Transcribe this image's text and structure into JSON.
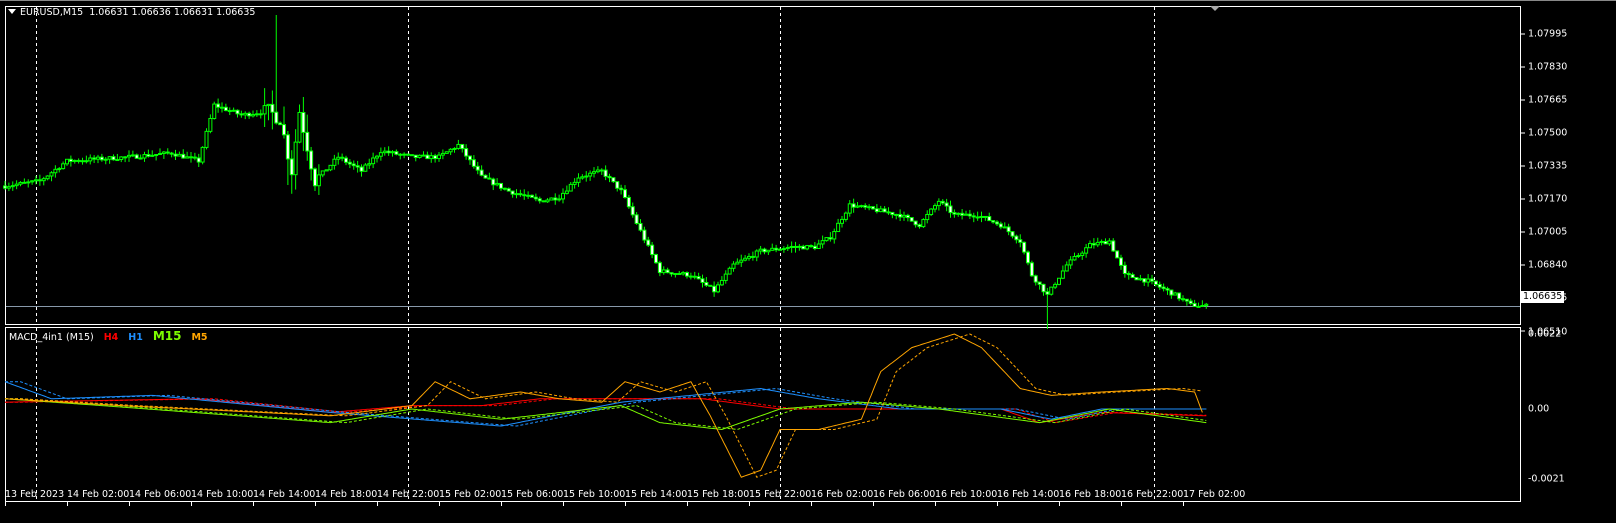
{
  "header": {
    "symbol": "EURUSD,M15",
    "quotes": "1.06631 1.06636 1.06631 1.06635"
  },
  "price_axis": {
    "labels": [
      "1.07995",
      "1.07830",
      "1.07665",
      "1.07500",
      "1.07335",
      "1.07170",
      "1.07005",
      "1.06840",
      "1.06675",
      "1.06510"
    ],
    "current_price": "1.06635"
  },
  "indicator": {
    "name": "MACD_4in1 (M15)",
    "legend": [
      {
        "label": "H4",
        "color": "#ff0000"
      },
      {
        "label": "H1",
        "color": "#1e90ff"
      },
      {
        "label": "M15",
        "color": "#7cfc00"
      },
      {
        "label": "M5",
        "color": "#ffa500"
      }
    ],
    "axis_labels": [
      "0.0022",
      "0.00",
      "-0.0021"
    ]
  },
  "time_axis": {
    "labels": [
      "13 Feb 2023",
      "14 Feb 02:00",
      "14 Feb 06:00",
      "14 Feb 10:00",
      "14 Feb 14:00",
      "14 Feb 18:00",
      "14 Feb 22:00",
      "15 Feb 02:00",
      "15 Feb 06:00",
      "15 Feb 10:00",
      "15 Feb 14:00",
      "15 Feb 18:00",
      "15 Feb 22:00",
      "16 Feb 02:00",
      "16 Feb 06:00",
      "16 Feb 10:00",
      "16 Feb 14:00",
      "16 Feb 18:00",
      "16 Feb 22:00",
      "17 Feb 02:00"
    ]
  },
  "colors": {
    "candle": "#00ff00",
    "bear_fill": "#ffffff",
    "grid": "#ffffff",
    "price_line": "#8899aa"
  },
  "chart_data": {
    "type": "candlestick",
    "timeframe": "M15",
    "price_range": [
      1.0651,
      1.08
    ],
    "close_path_bar_price": [
      [
        0,
        1.07235
      ],
      [
        9,
        1.0726
      ],
      [
        16,
        1.0736
      ],
      [
        32,
        1.0738
      ],
      [
        43,
        1.074
      ],
      [
        50,
        1.0736
      ],
      [
        54,
        1.0764
      ],
      [
        61,
        1.0759
      ],
      [
        68,
        1.0761
      ],
      [
        71,
        1.0757
      ],
      [
        74,
        1.0731
      ],
      [
        76,
        1.0761
      ],
      [
        80,
        1.0726
      ],
      [
        86,
        1.0738
      ],
      [
        92,
        1.0731
      ],
      [
        97,
        1.0741
      ],
      [
        105,
        1.0738
      ],
      [
        112,
        1.0738
      ],
      [
        117,
        1.0744
      ],
      [
        123,
        1.0728
      ],
      [
        130,
        1.0721
      ],
      [
        138,
        1.0716
      ],
      [
        143,
        1.0718
      ],
      [
        148,
        1.0728
      ],
      [
        154,
        1.0731
      ],
      [
        159,
        1.0721
      ],
      [
        164,
        1.0701
      ],
      [
        169,
        1.0681
      ],
      [
        177,
        1.0679
      ],
      [
        183,
        1.0671
      ],
      [
        188,
        1.0684
      ],
      [
        195,
        1.0691
      ],
      [
        203,
        1.0693
      ],
      [
        209,
        1.0693
      ],
      [
        213,
        1.0698
      ],
      [
        218,
        1.0714
      ],
      [
        226,
        1.0711
      ],
      [
        231,
        1.0709
      ],
      [
        236,
        1.0704
      ],
      [
        241,
        1.0716
      ],
      [
        245,
        1.0709
      ],
      [
        251,
        1.0709
      ],
      [
        257,
        1.0704
      ],
      [
        262,
        1.0696
      ],
      [
        265,
        1.0679
      ],
      [
        269,
        1.0669
      ],
      [
        274,
        1.0684
      ],
      [
        280,
        1.0694
      ],
      [
        285,
        1.0696
      ],
      [
        289,
        1.0679
      ],
      [
        295,
        1.0676
      ],
      [
        302,
        1.0669
      ],
      [
        306,
        1.0664
      ],
      [
        310,
        1.06635
      ]
    ],
    "macd": {
      "range": [
        -0.0021,
        0.0022
      ],
      "series": [
        {
          "name": "H4",
          "points": [
            [
              0,
              0.0002
            ],
            [
              50,
              0.0003
            ],
            [
              84,
              -0.0001
            ],
            [
              105,
              0.0001
            ],
            [
              123,
              0.0001
            ],
            [
              138,
              0.0003
            ],
            [
              180,
              0.0003
            ],
            [
              200,
              0.0
            ],
            [
              222,
              0.0
            ],
            [
              257,
              0.0
            ],
            [
              267,
              -0.0004
            ],
            [
              283,
              -0.0001
            ],
            [
              310,
              -0.0002
            ]
          ]
        },
        {
          "name": "H1",
          "points": [
            [
              0,
              0.0008
            ],
            [
              12,
              0.0003
            ],
            [
              38,
              0.0004
            ],
            [
              84,
              -0.0001
            ],
            [
              128,
              -0.0005
            ],
            [
              159,
              0.0002
            ],
            [
              195,
              0.0006
            ],
            [
              210,
              0.0003
            ],
            [
              231,
              0.0
            ],
            [
              257,
              0.0
            ],
            [
              270,
              -0.0003
            ],
            [
              283,
              0.0
            ],
            [
              310,
              0.0
            ]
          ]
        },
        {
          "name": "M15",
          "points": [
            [
              0,
              0.0003
            ],
            [
              25,
              0.0001
            ],
            [
              84,
              -0.0004
            ],
            [
              105,
              0.0
            ],
            [
              128,
              -0.0003
            ],
            [
              159,
              0.0001
            ],
            [
              169,
              -0.0004
            ],
            [
              185,
              -0.0006
            ],
            [
              200,
              0.0
            ],
            [
              221,
              0.0002
            ],
            [
              241,
              0.0
            ],
            [
              267,
              -0.0004
            ],
            [
              285,
              0.0
            ],
            [
              310,
              -0.0004
            ]
          ]
        },
        {
          "name": "M5",
          "points": [
            [
              0,
              0.0003
            ],
            [
              30,
              0.0001
            ],
            [
              84,
              -0.0002
            ],
            [
              105,
              0.0001
            ],
            [
              111,
              0.0008
            ],
            [
              120,
              0.0003
            ],
            [
              133,
              0.0005
            ],
            [
              143,
              0.0003
            ],
            [
              154,
              0.0002
            ],
            [
              160,
              0.0008
            ],
            [
              169,
              0.0005
            ],
            [
              177,
              0.0008
            ],
            [
              182,
              -0.0002
            ],
            [
              190,
              -0.002
            ],
            [
              195,
              -0.0018
            ],
            [
              200,
              -0.0006
            ],
            [
              210,
              -0.0006
            ],
            [
              221,
              -0.0003
            ],
            [
              226,
              0.0011
            ],
            [
              234,
              0.0018
            ],
            [
              245,
              0.0022
            ],
            [
              252,
              0.0018
            ],
            [
              262,
              0.0006
            ],
            [
              270,
              0.0004
            ],
            [
              283,
              0.0005
            ],
            [
              300,
              0.0006
            ],
            [
              307,
              0.0005
            ],
            [
              309,
              -0.0001
            ]
          ]
        }
      ]
    }
  }
}
